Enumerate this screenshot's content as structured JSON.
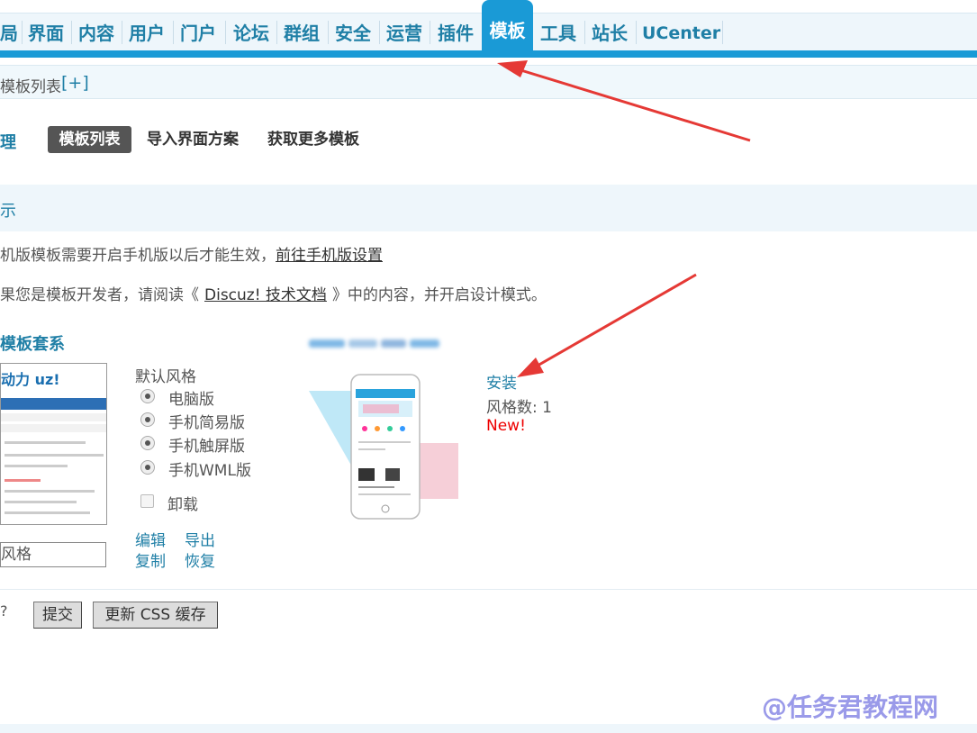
{
  "nav": {
    "items": [
      {
        "label": "局"
      },
      {
        "label": "界面"
      },
      {
        "label": "内容"
      },
      {
        "label": "用户"
      },
      {
        "label": "门户"
      },
      {
        "label": "论坛"
      },
      {
        "label": "群组"
      },
      {
        "label": "安全"
      },
      {
        "label": "运营"
      },
      {
        "label": "插件"
      },
      {
        "label": "模板"
      },
      {
        "label": "工具"
      },
      {
        "label": "站长"
      },
      {
        "label": "UCenter"
      }
    ],
    "active_index": 10,
    "accent_color": "#1a9ad6"
  },
  "breadcrumb": {
    "text": "模板列表",
    "add": "[+]"
  },
  "section": {
    "title": "理",
    "tabs": [
      {
        "label": "模板列表"
      },
      {
        "label": "导入界面方案"
      },
      {
        "label": "获取更多模板"
      }
    ]
  },
  "tips": {
    "title": "示",
    "line1": "机版模板需要开启手机版以后才能生效，",
    "line1_link": "前往手机版设置",
    "line2_prefix": "果您是模板开发者，请阅读《",
    "line2_link": "Discuz! 技术文档",
    "line2_suffix": "》中的内容，并开启设计模式。"
  },
  "template_set": {
    "title": "模板套系",
    "preview_logo": "动力 uz!",
    "style_input_value": "风格",
    "default_style_label": "默认风格",
    "radios": [
      {
        "label": "电脑版"
      },
      {
        "label": "手机简易版"
      },
      {
        "label": "手机触屏版"
      },
      {
        "label": "手机WML版"
      }
    ],
    "uninstall_label": "卸载",
    "ops": {
      "edit": "编辑",
      "export": "导出",
      "copy": "复制",
      "restore": "恢复"
    }
  },
  "mobile_template": {
    "install_label": "安装",
    "style_count": "风格数: 1",
    "new_label": "New!"
  },
  "footer": {
    "qmark": "?",
    "submit_label": "提交",
    "update_css_label": "更新 CSS 缓存"
  },
  "watermark": "@任务君教程网"
}
